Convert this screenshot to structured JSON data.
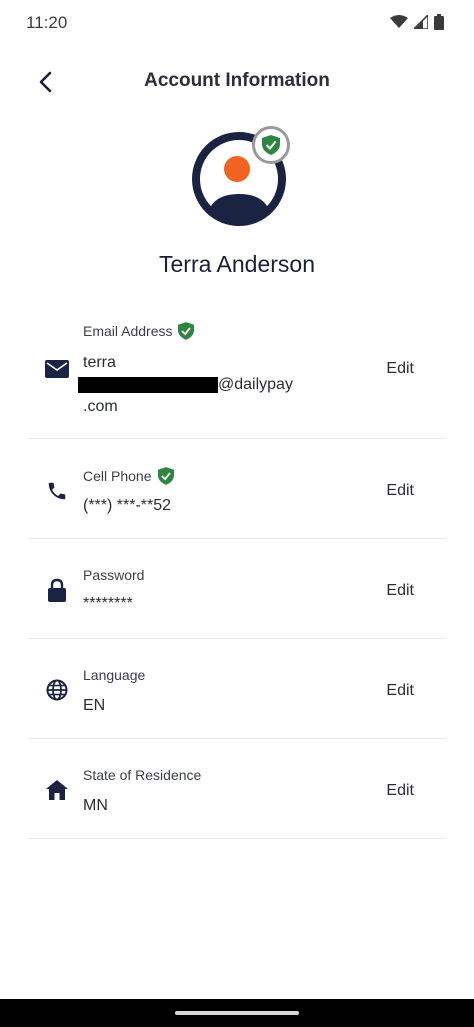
{
  "status_bar": {
    "time": "11:20"
  },
  "header": {
    "title": "Account Information"
  },
  "profile": {
    "name": "Terra Anderson"
  },
  "colors": {
    "navy": "#1b2343",
    "orange": "#f26322",
    "verified_green": "#2e8540"
  },
  "rows": [
    {
      "label": "Email Address",
      "verified": true,
      "value_line1": "terra",
      "value_line2_suffix": "@dailypay",
      "value_line3": ".com",
      "edit": "Edit",
      "icon": "envelope-icon"
    },
    {
      "label": "Cell Phone",
      "verified": true,
      "value": "(***) ***-**52",
      "edit": "Edit",
      "icon": "phone-icon"
    },
    {
      "label": "Password",
      "value": "********",
      "edit": "Edit",
      "icon": "lock-icon"
    },
    {
      "label": "Language",
      "value": "EN",
      "edit": "Edit",
      "icon": "globe-icon"
    },
    {
      "label": "State of Residence",
      "value": "MN",
      "edit": "Edit",
      "icon": "home-icon"
    }
  ]
}
